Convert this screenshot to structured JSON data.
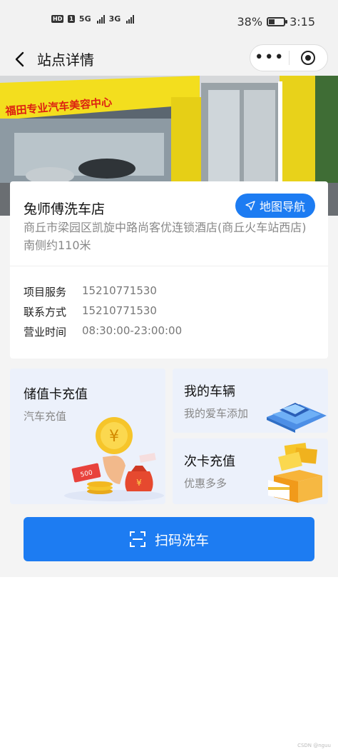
{
  "status": {
    "hd": "HD",
    "sim_badge": "1",
    "net1": "5G",
    "net2": "3G",
    "battery_pct": "38%",
    "battery_level": 0.38,
    "time": "3:15"
  },
  "nav": {
    "title": "站点详情",
    "more": "•••"
  },
  "hero": {
    "sign_text": "福田专业汽车美容中心"
  },
  "shop": {
    "name": "兔师傅洗车店",
    "nav_button": "地图导航",
    "address": "商丘市梁园区凯旋中路尚客优连锁酒店(商丘火车站西店)南侧约110米",
    "details": [
      {
        "label": "项目服务",
        "value": "15210771530"
      },
      {
        "label": "联系方式",
        "value": "15210771530"
      },
      {
        "label": "营业时间",
        "value": "08:30:00-23:00:00"
      }
    ]
  },
  "tiles": {
    "recharge": {
      "title": "储值卡充值",
      "subtitle": "汽车充值",
      "badge": "500"
    },
    "vehicle": {
      "title": "我的车辆",
      "subtitle": "我的爱车添加"
    },
    "times": {
      "title": "次卡充值",
      "subtitle": "优惠多多"
    }
  },
  "scan_button": "扫码洗车",
  "watermark": "CSDN @nguu",
  "colors": {
    "primary": "#1d7cf2",
    "tile_bg": "#ecf1fb",
    "page_bg": "#f4f4f4"
  }
}
